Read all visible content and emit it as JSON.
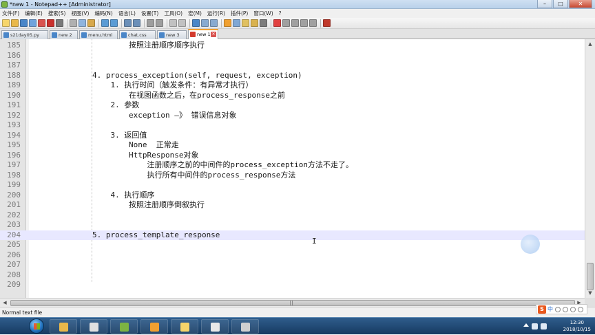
{
  "window": {
    "title": "*new 1 - Notepad++ [Administrator]",
    "controls": [
      "–",
      "□",
      "✕"
    ]
  },
  "menu": [
    "文件(F)",
    "编辑(E)",
    "搜索(S)",
    "视图(V)",
    "编码(N)",
    "语言(L)",
    "设置(T)",
    "工具(O)",
    "宏(M)",
    "运行(R)",
    "插件(P)",
    "窗口(W)",
    "?"
  ],
  "toolbar": {
    "groups": [
      [
        "new-file-icon",
        "open-file-icon",
        "save-icon",
        "save-all-icon",
        "close-icon",
        "close-all-icon",
        "print-icon"
      ],
      [
        "cut-icon",
        "copy-icon",
        "paste-icon"
      ],
      [
        "undo-icon",
        "redo-icon"
      ],
      [
        "find-icon",
        "replace-icon"
      ],
      [
        "zoom-in-icon",
        "zoom-out-icon"
      ],
      [
        "sync-v-icon",
        "sync-h-icon"
      ],
      [
        "word-wrap-icon",
        "show-all-chars-icon",
        "indent-guide-icon"
      ],
      [
        "udl-icon",
        "doc-map-icon",
        "function-list-icon",
        "folder-workspace-icon",
        "monitor-icon"
      ],
      [
        "record-macro-icon",
        "stop-macro-icon",
        "play-macro-icon",
        "play-multiple-icon",
        "save-macro-icon"
      ],
      [
        "spellcheck-icon"
      ]
    ],
    "colors": [
      "#f6d56a",
      "#e9b84a",
      "#4a86c8",
      "#6fa3dc",
      "#d9534f",
      "#c9302c",
      "#7a7a7a",
      "#b0b0b0",
      "#8fb4de",
      "#d7a84b",
      "#5a9bd4",
      "#5a9bd4",
      "#6b8fb8",
      "#6b8fb8",
      "#9e9e9e",
      "#9e9e9e",
      "#c1c1c1",
      "#c1c1c1",
      "#4a86c8",
      "#88aad0",
      "#88aad0",
      "#f0a030",
      "#7fa7d4",
      "#e0c060",
      "#d9b24f",
      "#7d7d7d",
      "#e04040",
      "#a0a0a0",
      "#a0a0a0",
      "#a0a0a0",
      "#a0a0a0",
      "#c0392b"
    ]
  },
  "tabs": [
    {
      "label": "s21day05.py",
      "active": false
    },
    {
      "label": "new 2",
      "active": false
    },
    {
      "label": "menu.html",
      "active": false
    },
    {
      "label": "chat.css",
      "active": false
    },
    {
      "label": "new 3",
      "active": false
    },
    {
      "label": "new 1",
      "active": true
    }
  ],
  "editor": {
    "current_line": 204,
    "lines": [
      {
        "n": "185",
        "text": "        按照注册顺序顺序执行"
      },
      {
        "n": "186",
        "text": ""
      },
      {
        "n": "187",
        "text": ""
      },
      {
        "n": "188",
        "text": "4. process_exception(self, request, exception)"
      },
      {
        "n": "189",
        "text": "    1. 执行时间（触发条件：有异常才执行）"
      },
      {
        "n": "190",
        "text": "        在视图函数之后，在process_response之前"
      },
      {
        "n": "191",
        "text": "    2. 参数"
      },
      {
        "n": "192",
        "text": "        exception —》 错误信息对象"
      },
      {
        "n": "193",
        "text": ""
      },
      {
        "n": "194",
        "text": "    3. 返回值"
      },
      {
        "n": "195",
        "text": "        None  正常走"
      },
      {
        "n": "196",
        "text": "        HttpResponse对象"
      },
      {
        "n": "197",
        "text": "            注册顺序之前的中间件的process_exception方法不走了。"
      },
      {
        "n": "198",
        "text": "            执行所有中间件的process_response方法"
      },
      {
        "n": "199",
        "text": ""
      },
      {
        "n": "200",
        "text": "    4. 执行顺序"
      },
      {
        "n": "201",
        "text": "        按照注册顺序倒叙执行"
      },
      {
        "n": "202",
        "text": ""
      },
      {
        "n": "203",
        "text": ""
      },
      {
        "n": "204",
        "text": "5. process_template_response"
      },
      {
        "n": "205",
        "text": ""
      },
      {
        "n": "206",
        "text": ""
      },
      {
        "n": "207",
        "text": ""
      },
      {
        "n": "208",
        "text": ""
      },
      {
        "n": "209",
        "text": ""
      }
    ],
    "caret_glyph": "I"
  },
  "scrollbars": {
    "up": "▲",
    "down": "▼",
    "left": "◀",
    "right": "▶"
  },
  "status": {
    "file_type": "Normal text file"
  },
  "ime": {
    "logo": "S",
    "mode": "中"
  },
  "taskbar": {
    "apps": [
      {
        "name": "taskbar-app-1",
        "color": "#e9b84a"
      },
      {
        "name": "taskbar-app-2",
        "color": "#e0e0e0"
      },
      {
        "name": "taskbar-app-3",
        "color": "#7cb342"
      },
      {
        "name": "taskbar-app-4",
        "color": "#f0a030"
      },
      {
        "name": "taskbar-app-5",
        "color": "#f6d56a"
      },
      {
        "name": "taskbar-app-6",
        "color": "#e8e8e8"
      },
      {
        "name": "taskbar-app-7",
        "color": "#d0d0d0"
      }
    ],
    "clock_time": "12:30",
    "clock_date": "2018/10/15"
  },
  "colors": {
    "current_line_bg": "#e8e8ff",
    "active_tab_accent": "#f0a030",
    "taskbar": "#173a61"
  }
}
